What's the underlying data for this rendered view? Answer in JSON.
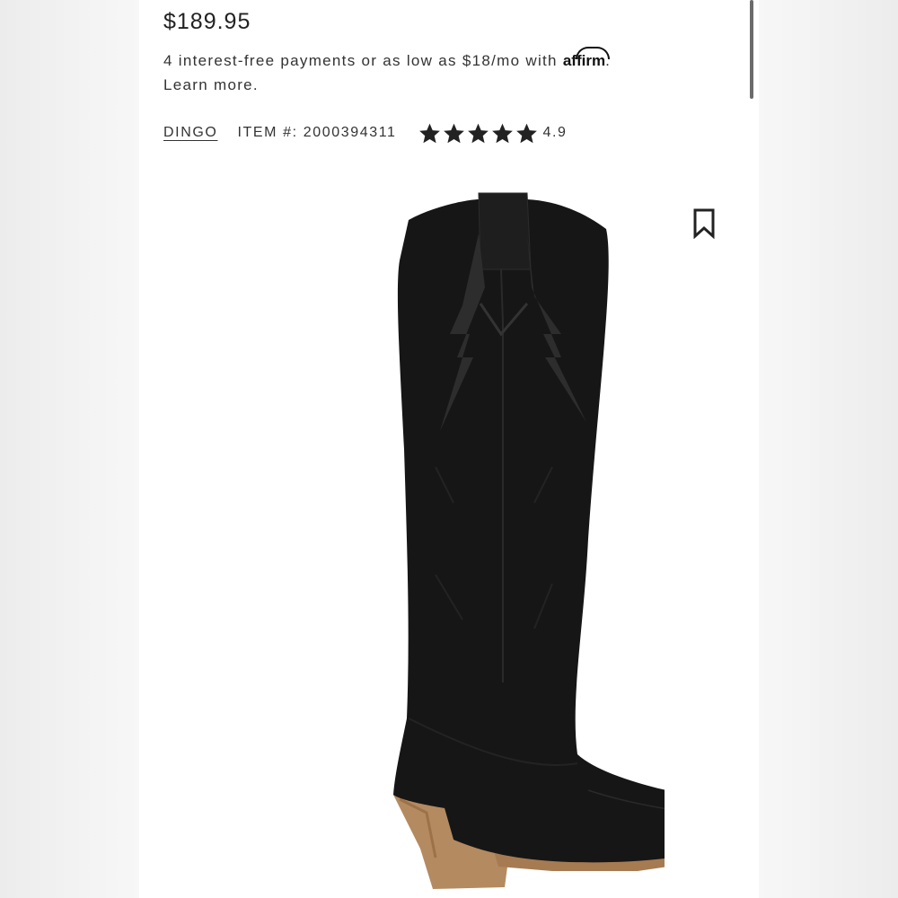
{
  "product": {
    "price": "$189.95",
    "financing_text": "4 interest-free payments or as low as $18/mo with ",
    "affirm_label": "affirm",
    "financing_end": ".",
    "learn_more": "Learn more.",
    "brand": "DINGO",
    "item_label": "ITEM #: 2000394311",
    "rating": "4.9",
    "stars_filled": 5,
    "stars_total": 5
  },
  "icons": {
    "star": "star-icon",
    "bookmark": "bookmark-icon"
  },
  "colors": {
    "text": "#222222",
    "star": "#222222",
    "boot": "#1a1a1a",
    "heel": "#b48a60"
  }
}
